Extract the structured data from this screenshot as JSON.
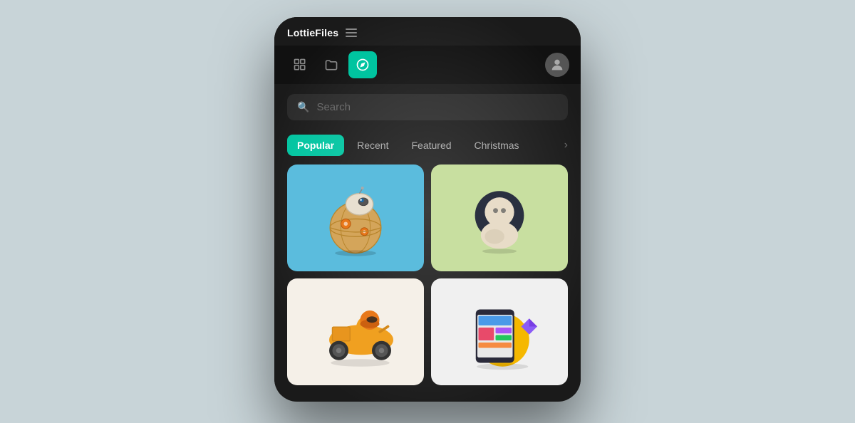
{
  "app": {
    "name": "LottieFiles",
    "menu_icon": "hamburger-icon"
  },
  "nav": {
    "icons": [
      {
        "id": "home-icon",
        "active": false,
        "label": "Home"
      },
      {
        "id": "folder-icon",
        "active": false,
        "label": "Folder"
      },
      {
        "id": "discover-icon",
        "active": true,
        "label": "Discover"
      }
    ],
    "profile_icon": "user-icon"
  },
  "search": {
    "placeholder": "Search"
  },
  "tabs": [
    {
      "id": "popular",
      "label": "Popular",
      "active": true
    },
    {
      "id": "recent",
      "label": "Recent",
      "active": false
    },
    {
      "id": "featured",
      "label": "Featured",
      "active": false
    },
    {
      "id": "christmas",
      "label": "Christmas",
      "active": false
    }
  ],
  "colors": {
    "active_tab_bg": "#00c4a0",
    "active_nav_bg": "#00c4a0",
    "bg_dark": "#1a1a1a",
    "card1_bg": "#5bbcdd",
    "card2_bg": "#c8dfa0",
    "card3_bg": "#f5f0e8",
    "card4_bg": "#f0f0f0"
  },
  "grid": {
    "cards": [
      {
        "id": "bb8-card",
        "theme": "bb8"
      },
      {
        "id": "character-card",
        "theme": "character"
      },
      {
        "id": "delivery-card",
        "theme": "delivery"
      },
      {
        "id": "design-card",
        "theme": "design"
      }
    ]
  }
}
